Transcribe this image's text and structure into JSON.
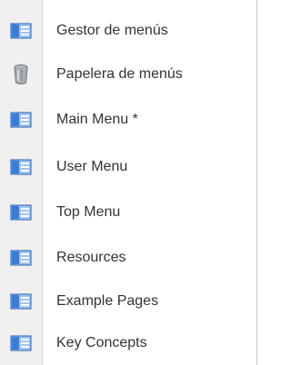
{
  "menu": {
    "items": [
      {
        "label": "Gestor de menús",
        "icon": "menu-manager-icon"
      },
      {
        "label": "Papelera de menús",
        "icon": "trash-icon"
      },
      {
        "label": "Main Menu *",
        "icon": "menu-icon"
      },
      {
        "label": "User Menu",
        "icon": "menu-icon"
      },
      {
        "label": "Top Menu",
        "icon": "menu-icon"
      },
      {
        "label": "Resources",
        "icon": "menu-icon"
      },
      {
        "label": "Example Pages",
        "icon": "menu-icon"
      },
      {
        "label": "Key Concepts",
        "icon": "menu-icon"
      }
    ]
  },
  "colors": {
    "icon_blue": "#3a7dd8",
    "icon_light": "#9ec4f2",
    "text": "#333333"
  }
}
